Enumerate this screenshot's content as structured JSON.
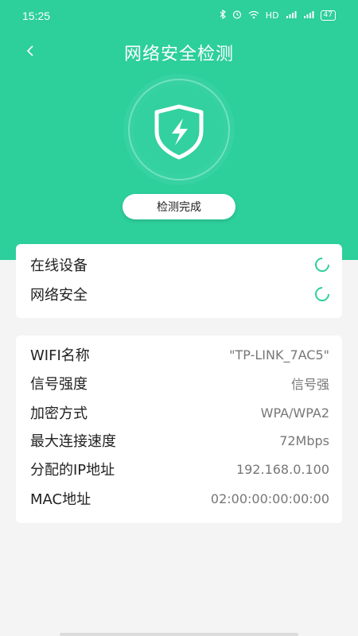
{
  "status_bar": {
    "time": "15:25",
    "icons": [
      "bluetooth-icon",
      "alarm-icon",
      "wifi-icon",
      "hd-icon",
      "signal-icon",
      "signal-icon",
      "battery-icon"
    ],
    "hd_label": "HD",
    "battery": "47"
  },
  "header": {
    "title": "网络安全检测",
    "back_icon": "chevron-left-icon"
  },
  "hero": {
    "icon": "shield-lightning-icon",
    "button_label": "检测完成"
  },
  "check_card": {
    "items": [
      {
        "label": "在线设备",
        "status_icon": "loading-icon"
      },
      {
        "label": "网络安全",
        "status_icon": "loading-icon"
      }
    ]
  },
  "info_card": {
    "rows": [
      {
        "label": "WIFI名称",
        "value": "\"TP-LINK_7AC5\""
      },
      {
        "label": "信号强度",
        "value": "信号强"
      },
      {
        "label": "加密方式",
        "value": "WPA/WPA2"
      },
      {
        "label": "最大连接速度",
        "value": "72Mbps"
      },
      {
        "label": "分配的IP地址",
        "value": "192.168.0.100"
      },
      {
        "label": "MAC地址",
        "value": "02:00:00:00:00:00"
      }
    ]
  },
  "colors": {
    "accent": "#2dcf9b",
    "background": "#f4f4f4",
    "card": "#ffffff"
  }
}
